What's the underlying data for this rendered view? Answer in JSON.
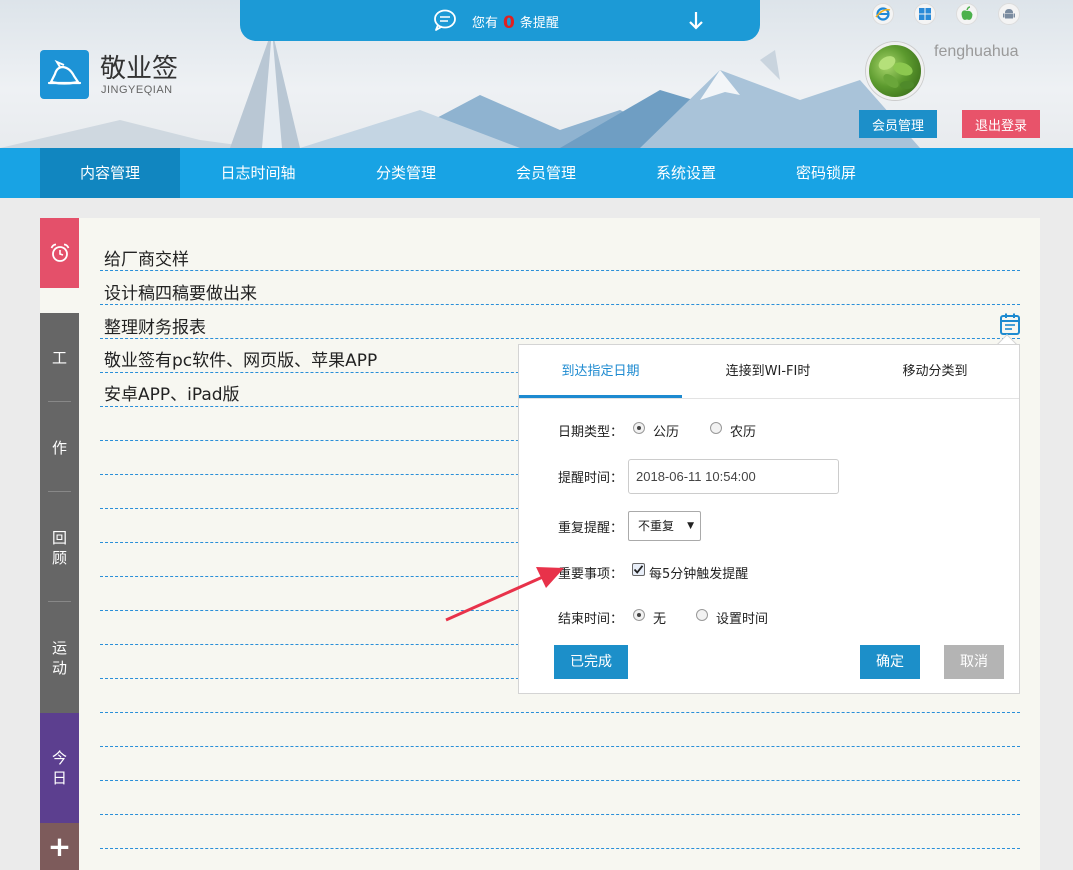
{
  "app": {
    "name": "敬业签",
    "subtitle": "JINGYEQIAN"
  },
  "reminder_bar": {
    "prefix": "您有",
    "count": "0",
    "suffix": "条提醒",
    "icons": [
      "chat-bubble-icon",
      "down-arrow-icon"
    ]
  },
  "platforms": [
    "ie-icon",
    "windows-icon",
    "apple-icon",
    "android-icon"
  ],
  "user": {
    "name": "fenghuahua",
    "member_btn": "会员管理",
    "logout_btn": "退出登录"
  },
  "nav": {
    "items": [
      "内容管理",
      "日志时间轴",
      "分类管理",
      "会员管理",
      "系统设置",
      "密码锁屏"
    ],
    "active": 0
  },
  "sidebar": {
    "work_labels": [
      "工",
      "作",
      "回顾",
      "运动"
    ],
    "today_label": "今日",
    "add_label": "+"
  },
  "tasks": [
    "给厂商交样",
    "设计稿四稿要做出来",
    "整理财务报表",
    "敬业签有pc软件、网页版、苹果APP",
    "安卓APP、iPad版"
  ],
  "popup": {
    "tabs": [
      "到达指定日期",
      "连接到WI-FI时",
      "移动分类到"
    ],
    "active_tab": 0,
    "date_type": {
      "label": "日期类型：",
      "options": [
        "公历",
        "农历"
      ],
      "selected": "公历"
    },
    "remind_time": {
      "label": "提醒时间：",
      "value": "2018-06-11 10:54:00"
    },
    "repeat": {
      "label": "重复提醒：",
      "value": "不重复"
    },
    "important": {
      "label": "重要事项：",
      "checkbox_text": "每5分钟触发提醒",
      "checked": true
    },
    "end_time": {
      "label": "结束时间：",
      "options": [
        "无",
        "设置时间"
      ],
      "selected": "无"
    },
    "buttons": {
      "done": "已完成",
      "ok": "确定",
      "cancel": "取消"
    }
  },
  "colors": {
    "nav_bg": "#18a3e4",
    "nav_active": "#1186c0",
    "accent_blue": "#1c8fc9",
    "logout_red": "#e8536a",
    "alarm_red": "#e4506a",
    "work_gray": "#666666",
    "today_purple": "#5c3f8f",
    "add_brown": "#7d5b5b",
    "annotation_arrow": "#e8324a"
  }
}
